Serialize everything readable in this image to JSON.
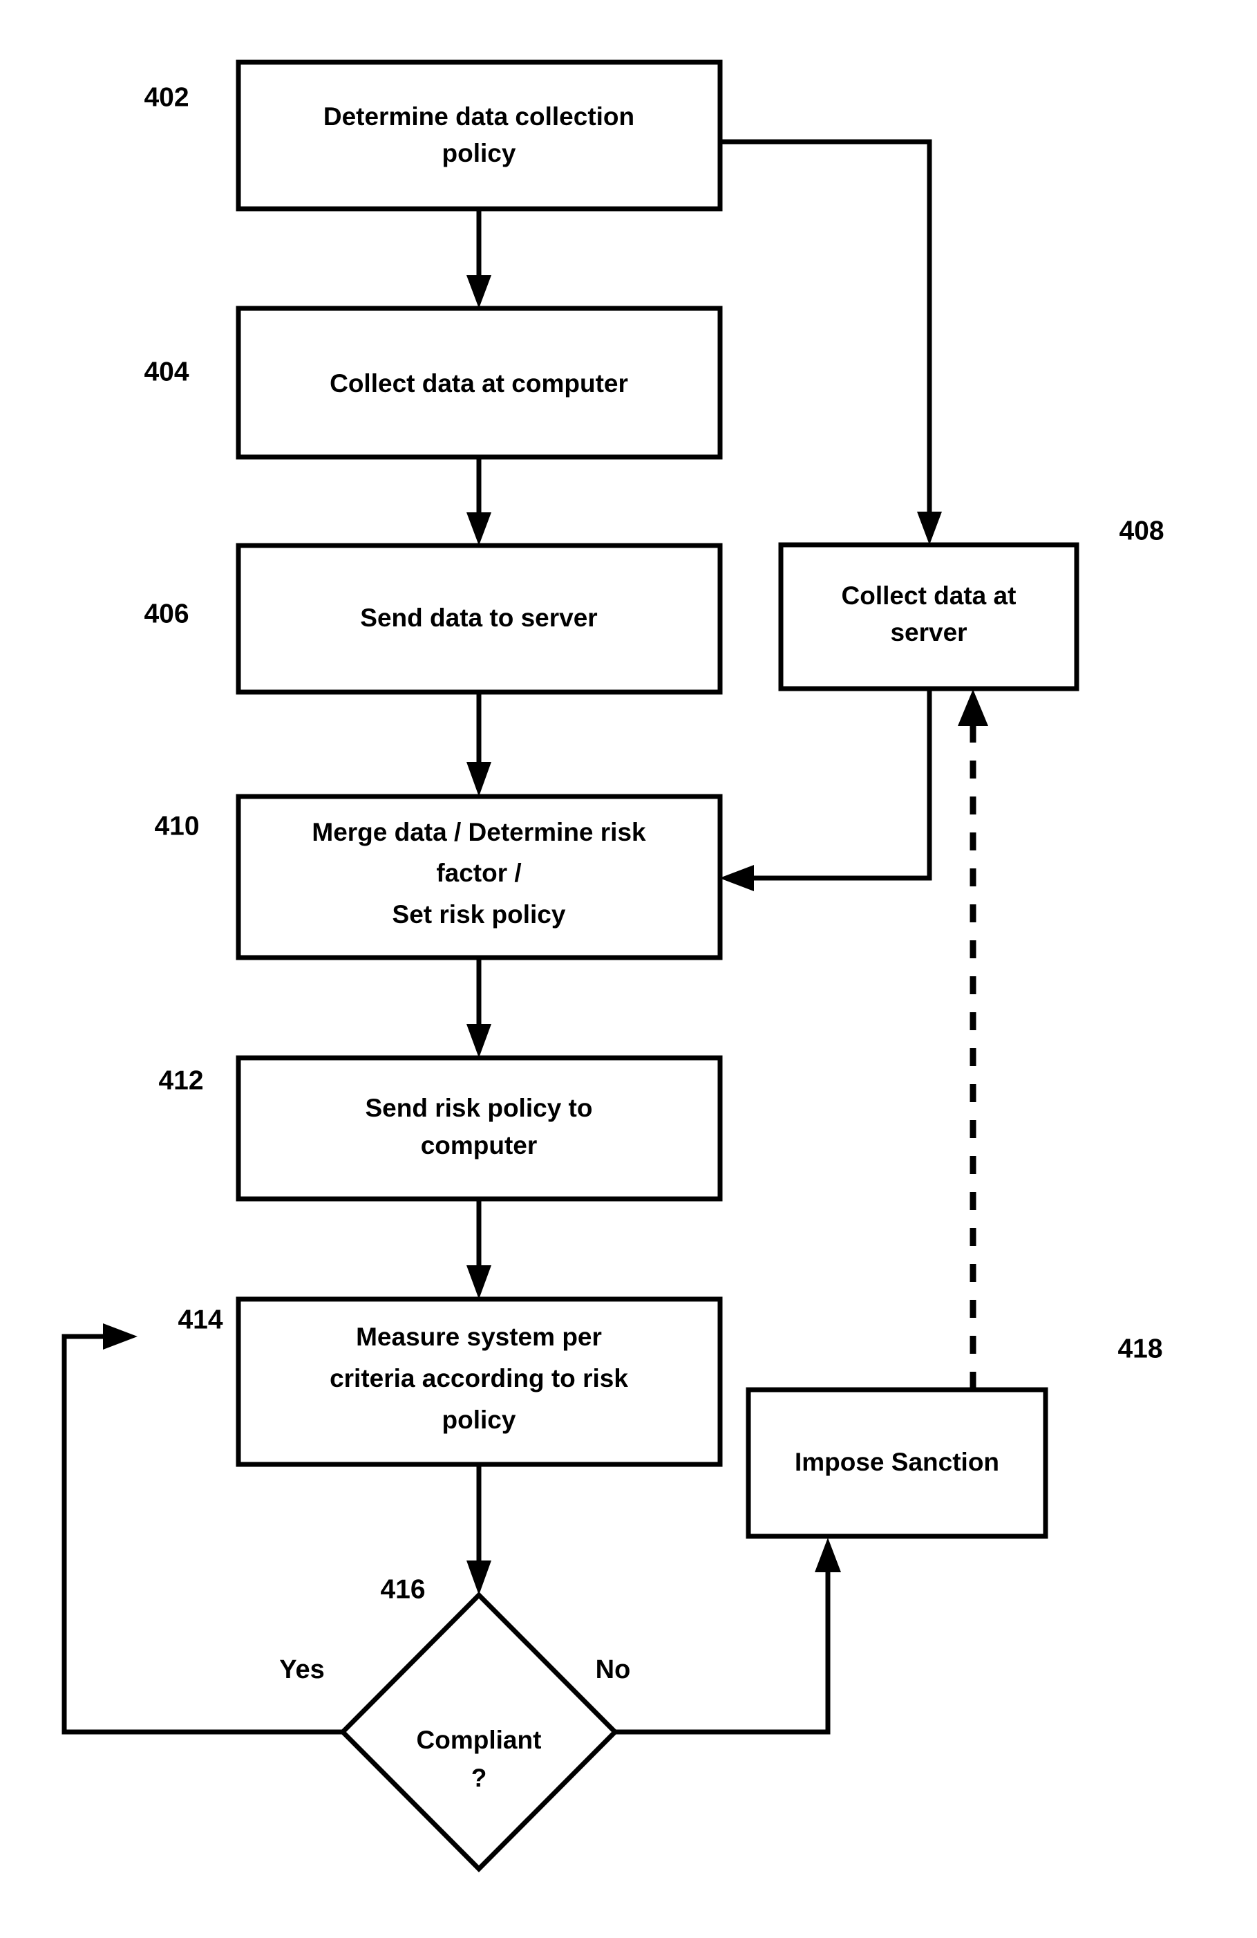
{
  "figure": {
    "type": "flowchart",
    "orientation": "vertical",
    "background_color": "#ffffff",
    "line_color": "#000000"
  },
  "nodes": {
    "n402": {
      "ref": "402",
      "shape": "rectangle",
      "line1": "Determine data collection",
      "line2": "policy"
    },
    "n404": {
      "ref": "404",
      "shape": "rectangle",
      "line1": "Collect data at computer"
    },
    "n406": {
      "ref": "406",
      "shape": "rectangle",
      "line1": "Send data to server"
    },
    "n408": {
      "ref": "408",
      "shape": "rectangle",
      "line1": "Collect data at",
      "line2": "server"
    },
    "n410": {
      "ref": "410",
      "shape": "rectangle",
      "line1": "Merge data / Determine risk",
      "line2": "factor /",
      "line3": "Set  risk policy"
    },
    "n412": {
      "ref": "412",
      "shape": "rectangle",
      "line1": "Send risk policy to",
      "line2": "computer"
    },
    "n414": {
      "ref": "414",
      "shape": "rectangle",
      "line1": "Measure system per",
      "line2": "criteria according to risk",
      "line3": "policy"
    },
    "n416": {
      "ref": "416",
      "shape": "diamond",
      "line1": "Compliant",
      "line2": "?"
    },
    "n418": {
      "ref": "418",
      "shape": "rectangle",
      "line1": "Impose Sanction"
    }
  },
  "branch_labels": {
    "yes": "Yes",
    "no": "No"
  }
}
